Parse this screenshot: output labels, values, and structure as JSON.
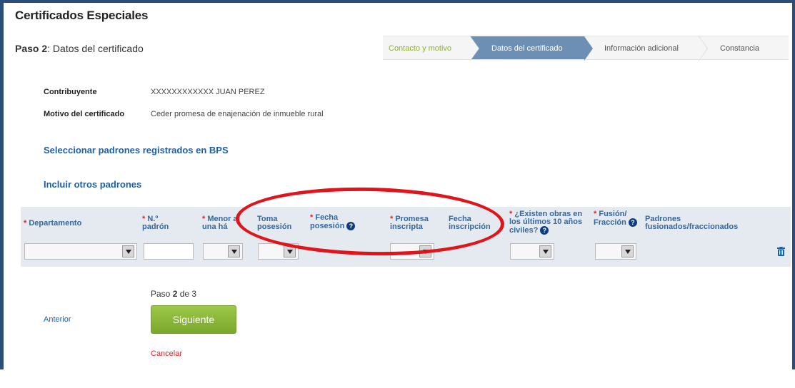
{
  "page": {
    "title": "Certificados Especiales",
    "step_prefix": "Paso 2",
    "step_name": ": Datos del certificado"
  },
  "wizard": {
    "steps": [
      {
        "label": "Contacto y motivo",
        "state": "done"
      },
      {
        "label": "Datos del certificado",
        "state": "active"
      },
      {
        "label": "Información adicional",
        "state": "pending"
      },
      {
        "label": "Constancia",
        "state": "pending"
      }
    ]
  },
  "info": {
    "contribuyente_label": "Contribuyente",
    "contribuyente_value": "XXXXXXXXXXXX JUAN PEREZ",
    "motivo_label": "Motivo del certificado",
    "motivo_value": "Ceder promesa de enajenación de inmueble rural"
  },
  "links": {
    "seleccionar": "Seleccionar padrones registrados en BPS",
    "incluir": "Incluir otros padrones"
  },
  "grid": {
    "columns": [
      {
        "key": "departamento",
        "required": true,
        "label": "Departamento",
        "help": false
      },
      {
        "key": "padron",
        "required": true,
        "label": "N.º padrón",
        "help": false
      },
      {
        "key": "menor",
        "required": true,
        "label": "Menor a una há",
        "help": false
      },
      {
        "key": "toma",
        "required": false,
        "label": "Toma posesión",
        "help": false
      },
      {
        "key": "fecha_posesion",
        "required": true,
        "label": "Fecha posesión",
        "help": true
      },
      {
        "key": "promesa",
        "required": true,
        "label": "Promesa inscripta",
        "help": false
      },
      {
        "key": "fecha_inscripcion",
        "required": false,
        "label": "Fecha inscripción",
        "help": false
      },
      {
        "key": "obras",
        "required": true,
        "label": "¿Existen obras en los últimos 10 años civiles?",
        "help": true
      },
      {
        "key": "fusion",
        "required": true,
        "label": "Fusión/ Fracción",
        "help": true
      },
      {
        "key": "padrones_fus",
        "required": false,
        "label": "Padrones fusionados/fraccionados",
        "help": false
      }
    ],
    "required_mark": "*",
    "help_glyph": "?"
  },
  "footer": {
    "paso_text": "Paso",
    "paso_current": "2",
    "paso_of": "de 3",
    "anterior": "Anterior",
    "siguiente": "Siguiente",
    "cancelar": "Cancelar"
  },
  "colors": {
    "frame": "#2b4f7a",
    "link": "#1f5fa6",
    "header_text": "#35669d",
    "required": "#d9262b",
    "wizard_active": "#6e8fb4",
    "wizard_done_text": "#8bb32a",
    "next_button": "#8cbb3a",
    "annotation_ellipse": "#e0141b"
  }
}
